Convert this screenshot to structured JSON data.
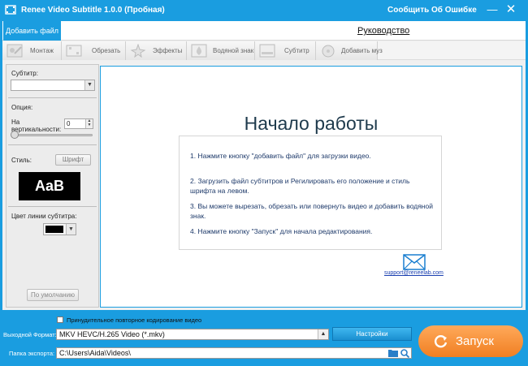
{
  "window": {
    "title": "Renee Video Subtitle 1.0.0 (Пробная)",
    "report_link": "Сообщить Об Ошибке",
    "minimize": "—",
    "close": "✕"
  },
  "top": {
    "add_file": "Добавить файл",
    "guide": "Руководство"
  },
  "toolbar": {
    "items": [
      {
        "label": "Монтаж",
        "icon": "montage-icon"
      },
      {
        "label": "Обрезать",
        "icon": "crop-icon"
      },
      {
        "label": "Эффекты",
        "icon": "effects-icon"
      },
      {
        "label": "Водяной знак",
        "icon": "watermark-icon"
      },
      {
        "label": "Субтитр",
        "icon": "subtitle-icon"
      },
      {
        "label": "Добавить муз",
        "icon": "music-icon"
      }
    ]
  },
  "left_panel": {
    "subtitle_label": "Субтитр:",
    "subtitle_value": "",
    "option_label": "Опция:",
    "vertical_label_1": "На",
    "vertical_label_2": "вертикальности:",
    "vertical_value": "0",
    "vertical_slider_level": 0,
    "style_label": "Стиль:",
    "font_button": "Шрифт",
    "preview_text": "AaB",
    "line_color_label": "Цвет линии субтитра:",
    "line_color": "#000000",
    "default_button": "По умолчанию"
  },
  "main": {
    "title": "Начало работы",
    "steps": [
      "1. Нажмите кнопку \"добавить файл\" для загрузки видео.",
      "2. Загрузить файл субтитров и Регилировать его положение и стиль шрифта на левом.",
      "3. Вы можете вырезать, обрезать или повернуть видео и добавить водяной знак.",
      "4. Нажмите кнопку \"Запуск\" для начала редактирования."
    ],
    "support_email": "support@reneelab.com"
  },
  "bottom": {
    "force_reencode_label": "Принудительное повторное кодирование видео",
    "force_reencode_checked": false,
    "output_format_label": "Выходной Формат:",
    "output_format_value": "MKV HEVC/H.265 Video (*.mkv)",
    "settings_button": "Настройки",
    "export_folder_label": "Папка экспорта:",
    "export_folder_value": "C:\\Users\\Aida\\Videos\\",
    "run_button": "Запуск"
  },
  "colors": {
    "accent": "#1a9de0",
    "run_button": "#f58a2c"
  }
}
